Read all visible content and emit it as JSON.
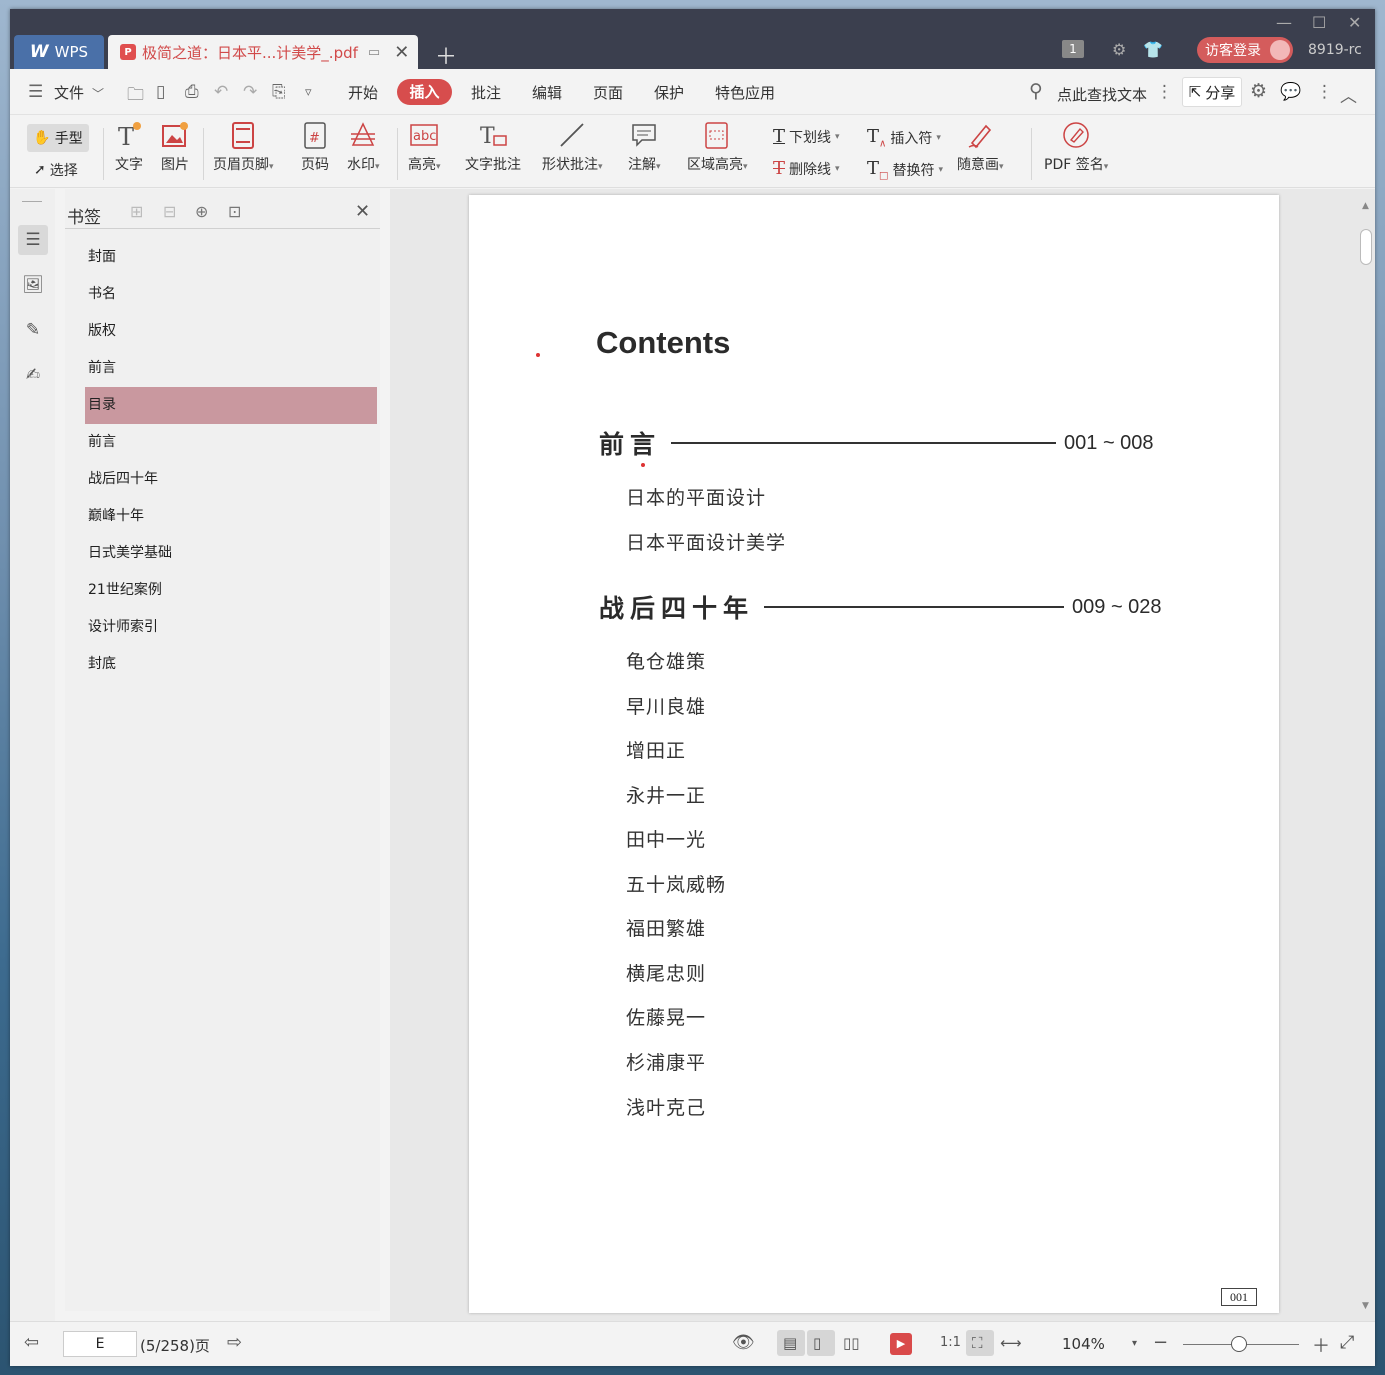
{
  "titlebar": {
    "app_tab": "WPS",
    "doc_tab": "极简之道：日本平...计美学_.pdf",
    "page_count_badge": "1",
    "login_label": "访客登录",
    "user_id": "8919-rc"
  },
  "menu": {
    "file": "文件",
    "items": [
      "开始",
      "插入",
      "批注",
      "编辑",
      "页面",
      "保护",
      "特色应用"
    ],
    "active": "插入",
    "search_placeholder": "点此查找文本",
    "share": "分享"
  },
  "ribbon": {
    "hand": "手型",
    "select": "选择",
    "text": "文字",
    "image": "图片",
    "header_footer": "页眉页脚",
    "page_number": "页码",
    "watermark": "水印",
    "highlight": "高亮",
    "text_comment": "文字批注",
    "shape_comment": "形状批注",
    "note": "注解",
    "area_highlight": "区域高亮",
    "underline": "下划线",
    "strikethrough": "删除线",
    "insert_mark": "插入符",
    "replace_mark": "替换符",
    "freehand": "随意画",
    "pdf_sign": "PDF 签名"
  },
  "bookmarks": {
    "title": "书签",
    "items": [
      "封面",
      "书名",
      "版权",
      "前言",
      "目录",
      "前言",
      "战后四十年",
      "巅峰十年",
      "日式美学基础",
      "21世纪案例",
      "设计师索引",
      "封底"
    ],
    "selected_index": 4
  },
  "document": {
    "heading": "Contents",
    "sections": [
      {
        "title": "前言",
        "range": "001 ~ 008",
        "entries": [
          "日本的平面设计",
          "日本平面设计美学"
        ]
      },
      {
        "title": "战后四十年",
        "range": "009 ~ 028",
        "entries": [
          "龟仓雄策",
          "早川良雄",
          "增田正",
          "永井一正",
          "田中一光",
          "五十岚威畅",
          "福田繁雄",
          "横尾忠则",
          "佐藤晃一",
          "杉浦康平",
          "浅叶克己"
        ]
      }
    ],
    "page_number": "001"
  },
  "status": {
    "page_input": "E",
    "page_total": "(5/258)页",
    "zoom": "104%"
  },
  "colors": {
    "accent": "#d74d4d",
    "bookmark_selected": "#c9989f",
    "titlebar": "#3b3f4e",
    "wps_tab": "#4a70a8"
  }
}
